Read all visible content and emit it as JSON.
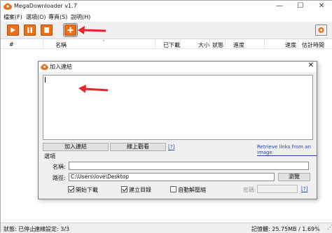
{
  "app": {
    "title": "MegaDownloader v1.7",
    "menu": [
      "檔案(F)",
      "選項(O)",
      "專頁(S)",
      "說明(H)"
    ],
    "window_buttons": [
      "—",
      "☐",
      "✕"
    ]
  },
  "toolbar": {
    "buttons": [
      "play-icon",
      "pause-icon",
      "stop-icon",
      "add-icon"
    ],
    "settings_icon": "settings-icon"
  },
  "list": {
    "columns": [
      "#",
      "名稱",
      "已下載",
      "大小",
      "狀態",
      "進度",
      "速度",
      "估計時間"
    ]
  },
  "status": {
    "left": "狀態: 已停止",
    "mid": "連線設定: 3/3",
    "memory": "記憶體: 25.75MB / 1.69%",
    "resize": "⋰"
  },
  "dialog": {
    "title": "加入連結",
    "close": "✕",
    "add_links_button": "加入連結",
    "watch_online_button": "線上觀看",
    "help_q": "[?]",
    "retrieve_link": "Retrieve links from an image",
    "options_title": "選項",
    "name_label": "名稱:",
    "name_value": "",
    "path_label": "路徑:",
    "path_value": "C:\\Users\\love\\Desktop",
    "browse_button": "瀏覽",
    "start_download_label": "開始下載",
    "create_folder_label": "建立目錄",
    "auto_extract_label": "自動解壓縮",
    "password_label": "密碼:",
    "password_value": ""
  },
  "colors": {
    "accent": "#e8701a",
    "arrow": "#e8232a",
    "link": "#2244aa"
  }
}
